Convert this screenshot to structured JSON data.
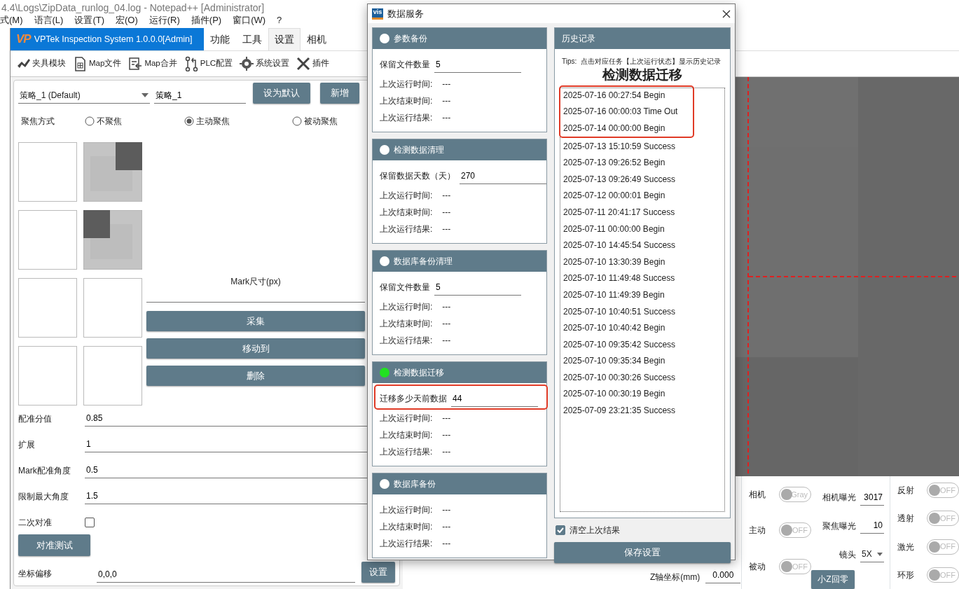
{
  "notepad": {
    "title": "4.4\\Logs\\ZipData_runlog_04.log - Notepad++ [Administrator]",
    "menu": [
      "式(M)",
      "语言(L)",
      "设置(T)",
      "宏(O)",
      "运行(R)",
      "插件(P)",
      "窗口(W)",
      "?"
    ]
  },
  "app": {
    "logo": "VP",
    "title": "VPTek Inspection System 1.0.0.0[Admin]",
    "tabs": [
      {
        "label": "功能",
        "selected": false
      },
      {
        "label": "工具",
        "selected": false
      },
      {
        "label": "设置",
        "selected": true
      },
      {
        "label": "相机",
        "selected": false
      }
    ],
    "toolbar": [
      {
        "kind": "fixture",
        "label": "夹具模块"
      },
      {
        "kind": "file",
        "label": "Map文件"
      },
      {
        "kind": "merge",
        "label": "Map合并"
      },
      {
        "kind": "plc",
        "label": "PLC配置"
      },
      {
        "kind": "gear",
        "label": "系统设置"
      },
      {
        "kind": "tools",
        "label": "插件"
      }
    ]
  },
  "strategy": {
    "select": "策略_1 (Default)",
    "name": "策略_1",
    "buttons": [
      "设为默认",
      "新增"
    ]
  },
  "focus": {
    "label": "聚焦方式",
    "options": [
      {
        "label": "不聚焦",
        "selected": false
      },
      {
        "label": "主动聚焦",
        "selected": true
      },
      {
        "label": "被动聚焦",
        "selected": false
      }
    ]
  },
  "thumbnails": [
    {
      "kind": "empty"
    },
    {
      "kind": "mark-top-right"
    },
    {
      "kind": "empty"
    },
    {
      "kind": "mark-top-left"
    },
    {
      "kind": "empty"
    },
    {
      "kind": "empty"
    },
    {
      "kind": "empty"
    },
    {
      "kind": "empty"
    }
  ],
  "mark_size": {
    "label": "Mark尺寸(px)"
  },
  "actions": [
    "采集",
    "移动到",
    "删除"
  ],
  "params": [
    {
      "label": "配准分值",
      "value": "0.85"
    },
    {
      "label": "扩展",
      "value": "1"
    },
    {
      "label": "Mark配准角度",
      "value": "0.5"
    },
    {
      "label": "限制最大角度",
      "value": "1.5"
    }
  ],
  "secondary_align": {
    "label": "二次对准",
    "checked": false
  },
  "align_test": "对准测试",
  "offset": {
    "label": "坐标偏移",
    "value": "0,0,0",
    "button": "设置"
  },
  "camera_controls": {
    "z": {
      "label": "Z轴坐标(mm)",
      "value": "0.000"
    },
    "home_button": "小Z回零",
    "modes": [
      {
        "label": "相机",
        "on": false,
        "text": "Gray"
      },
      {
        "label": "主动",
        "on": false,
        "text": "OFF"
      },
      {
        "label": "被动",
        "on": false,
        "text": "OFF"
      }
    ],
    "settings": [
      {
        "kind": "number",
        "label": "相机曝光",
        "value": "3017"
      },
      {
        "kind": "number",
        "label": "聚焦曝光",
        "value": "10"
      },
      {
        "kind": "select",
        "label": "镜头",
        "value": "5X"
      }
    ],
    "lights": [
      {
        "label": "反射",
        "on": false,
        "text": "OFF"
      },
      {
        "label": "透射",
        "on": false,
        "text": "OFF"
      },
      {
        "label": "激光",
        "on": false,
        "text": "OFF"
      },
      {
        "label": "环形",
        "on": false,
        "text": "OFF"
      }
    ]
  },
  "dialog": {
    "icon_text": "vis",
    "title": "数据服务",
    "sections": [
      {
        "title": "参数备份",
        "active": false,
        "field": {
          "label": "保留文件数量",
          "value": "5",
          "highlighted": false
        },
        "rows": [
          {
            "label": "上次运行时间:",
            "value": "---"
          },
          {
            "label": "上次结束时间:",
            "value": "---"
          },
          {
            "label": "上次运行结果:",
            "value": "---"
          }
        ]
      },
      {
        "title": "检测数据清理",
        "active": false,
        "field": {
          "label": "保留数据天数（天）",
          "value": "270",
          "highlighted": false
        },
        "rows": [
          {
            "label": "上次运行时间:",
            "value": "---"
          },
          {
            "label": "上次结束时间:",
            "value": "---"
          },
          {
            "label": "上次运行结果:",
            "value": "---"
          }
        ]
      },
      {
        "title": "数据库备份清理",
        "active": false,
        "field": {
          "label": "保留文件数量",
          "value": "5",
          "highlighted": false
        },
        "rows": [
          {
            "label": "上次运行时间:",
            "value": "---"
          },
          {
            "label": "上次结束时间:",
            "value": "---"
          },
          {
            "label": "上次运行结果:",
            "value": "---"
          }
        ]
      },
      {
        "title": "检测数据迁移",
        "active": true,
        "field": {
          "label": "迁移多少天前数据",
          "value": "44",
          "highlighted": true
        },
        "rows": [
          {
            "label": "上次运行时间:",
            "value": "---"
          },
          {
            "label": "上次结束时间:",
            "value": "---"
          },
          {
            "label": "上次运行结果:",
            "value": "---"
          }
        ]
      },
      {
        "title": "数据库备份",
        "active": false,
        "rows": [
          {
            "label": "上次运行时间:",
            "value": "---"
          },
          {
            "label": "上次结束时间:",
            "value": "---"
          },
          {
            "label": "上次运行结果:",
            "value": "---"
          }
        ]
      }
    ],
    "history": {
      "title": "历史记录",
      "tips": "Tips:  点击对应任务【上次运行状态】显示历史记录",
      "heading": "检测数据迁移",
      "entries": [
        {
          "text": "2025-07-16 00:27:54 Begin",
          "highlighted": true
        },
        {
          "text": "2025-07-16 00:00:03 Time Out",
          "highlighted": true
        },
        {
          "text": "2025-07-14 00:00:00 Begin",
          "highlighted": true
        },
        {
          "text": "2025-07-13 15:10:59 Success",
          "highlighted": false
        },
        {
          "text": "2025-07-13 09:26:52 Begin",
          "highlighted": false
        },
        {
          "text": "2025-07-13 09:26:49 Success",
          "highlighted": false
        },
        {
          "text": "2025-07-12 00:00:01 Begin",
          "highlighted": false
        },
        {
          "text": "2025-07-11 20:41:17 Success",
          "highlighted": false
        },
        {
          "text": "2025-07-11 00:00:00 Begin",
          "highlighted": false
        },
        {
          "text": "2025-07-10 14:45:54 Success",
          "highlighted": false
        },
        {
          "text": "2025-07-10 13:30:39 Begin",
          "highlighted": false
        },
        {
          "text": "2025-07-10 11:49:48 Success",
          "highlighted": false
        },
        {
          "text": "2025-07-10 11:49:39 Begin",
          "highlighted": false
        },
        {
          "text": "2025-07-10 10:40:51 Success",
          "highlighted": false
        },
        {
          "text": "2025-07-10 10:40:42 Begin",
          "highlighted": false
        },
        {
          "text": "2025-07-10 09:35:42 Success",
          "highlighted": false
        },
        {
          "text": "2025-07-10 09:35:34 Begin",
          "highlighted": false
        },
        {
          "text": "2025-07-10 00:30:26 Success",
          "highlighted": false
        },
        {
          "text": "2025-07-10 00:30:19 Begin",
          "highlighted": false
        },
        {
          "text": "2025-07-09 23:21:35 Success",
          "highlighted": false
        }
      ]
    },
    "clear_last": {
      "label": "清空上次结果",
      "checked": true
    },
    "save": "保存设置"
  }
}
